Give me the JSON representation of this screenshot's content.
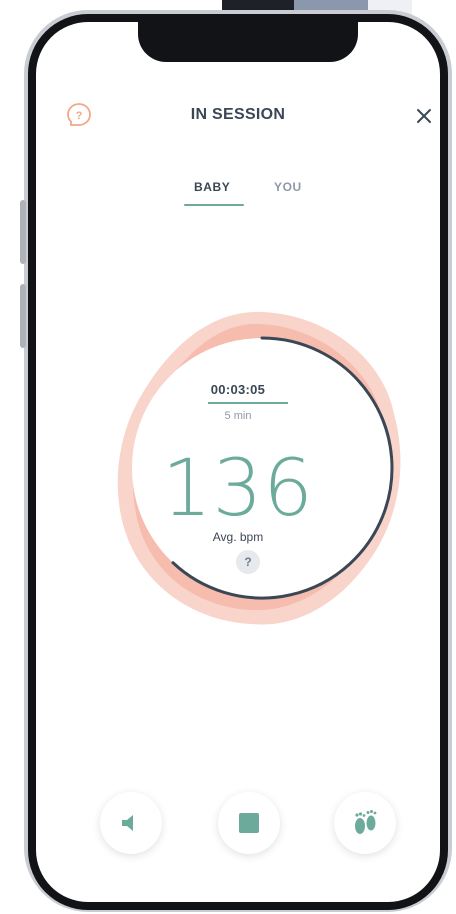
{
  "header": {
    "title": "IN SESSION",
    "help_icon": "help-bubble-icon",
    "close_icon": "close-icon"
  },
  "tabs": [
    {
      "label": "BABY",
      "active": true
    },
    {
      "label": "YOU",
      "active": false
    }
  ],
  "session": {
    "elapsed": "00:03:05",
    "duration": "5 min",
    "progress_fraction": 0.62,
    "bpm_value": "136",
    "bpm_label": "Avg. bpm",
    "info_badge": "?"
  },
  "controls": [
    {
      "name": "sound",
      "icon": "speaker-icon"
    },
    {
      "name": "stop",
      "icon": "stop-icon"
    },
    {
      "name": "kick",
      "icon": "baby-feet-icon"
    }
  ],
  "colors": {
    "accent": "#6cab9b",
    "text": "#3c4756",
    "muted": "#8e99a8",
    "wave": "#f4a899",
    "help": "#f1a887"
  }
}
